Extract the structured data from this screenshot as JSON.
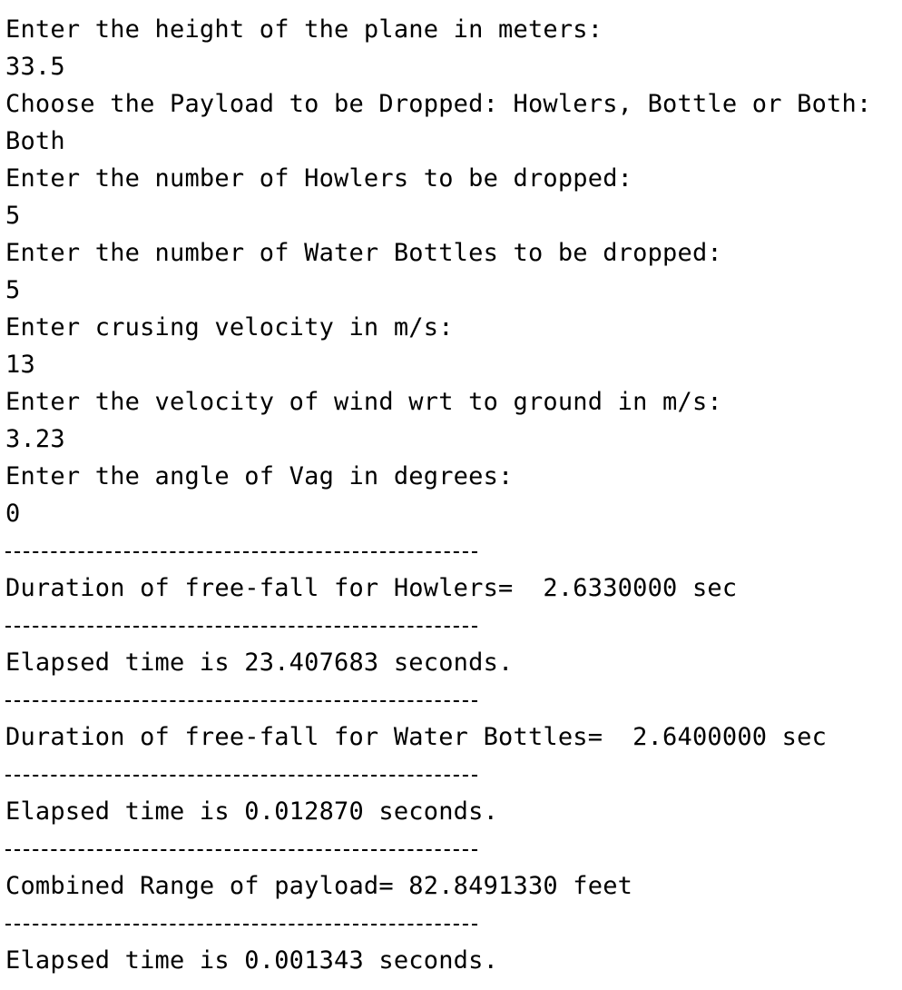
{
  "console": {
    "prompts": {
      "height_prompt": "Enter the height of the plane in meters:",
      "height_value": "33.5",
      "payload_prompt": "Choose the Payload to be Dropped: Howlers, Bottle or Both:",
      "payload_value": "Both",
      "howlers_prompt": "Enter the number of Howlers to be dropped:",
      "howlers_value": "5",
      "bottles_prompt": "Enter the number of Water Bottles to be dropped:",
      "bottles_value": "5",
      "velocity_prompt": "Enter crusing velocity in m/s:",
      "velocity_value": "13",
      "wind_prompt": "Enter the velocity of wind wrt to ground in m/s:",
      "wind_value": "3.23",
      "angle_prompt": "Enter the angle of Vag in degrees:",
      "angle_value": "0"
    },
    "results": {
      "howlers_duration": "Duration of free-fall for Howlers=  2.6330000 sec",
      "elapsed_1": "Elapsed time is 23.407683 seconds.",
      "bottles_duration": "Duration of free-fall for Water Bottles=  2.6400000 sec",
      "elapsed_2": "Elapsed time is 0.012870 seconds.",
      "combined_range": "Combined Range of payload= 82.8491330 feet",
      "elapsed_3": "Elapsed time is 0.001343 seconds."
    }
  }
}
